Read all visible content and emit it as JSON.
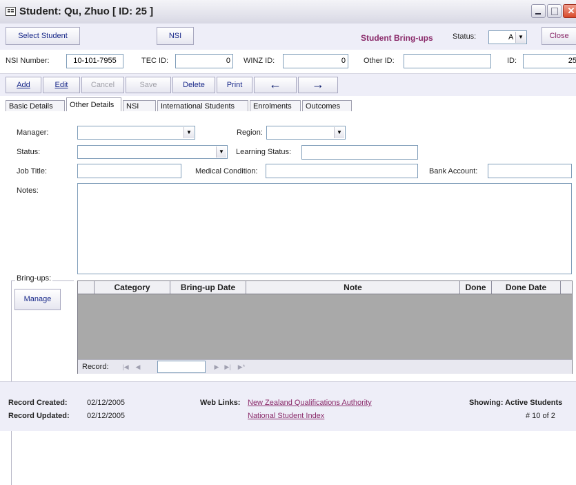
{
  "window": {
    "title": "Student: Qu, Zhuo [ ID: 25 ]"
  },
  "toolbar": {
    "select_student": "Select Student",
    "nsi": "NSI",
    "student_bringups": "Student Bring-ups",
    "status_label": "Status:",
    "status_value": "A",
    "close": "Close"
  },
  "ids": {
    "nsi_number_label": "NSI Number:",
    "nsi_number": "10-101-7955",
    "tec_id_label": "TEC ID:",
    "tec_id": "0",
    "winz_id_label": "WINZ ID:",
    "winz_id": "0",
    "other_id_label": "Other ID:",
    "other_id": "",
    "id_label": "ID:",
    "id": "25"
  },
  "commands": {
    "add": "Add",
    "edit": "Edit",
    "cancel": "Cancel",
    "save": "Save",
    "delete": "Delete",
    "print": "Print",
    "prev_icon": "arrow-left-icon",
    "next_icon": "arrow-right-icon"
  },
  "tabs": [
    "Basic Details",
    "Other Details",
    "NSI",
    "International Students",
    "Enrolments",
    "Outcomes"
  ],
  "form": {
    "manager_label": "Manager:",
    "region_label": "Region:",
    "status_label": "Status:",
    "learning_status_label": "Learning Status:",
    "job_title_label": "Job Title:",
    "medical_condition_label": "Medical Condition:",
    "bank_account_label": "Bank Account:",
    "notes_label": "Notes:"
  },
  "bringups": {
    "label": "Bring-ups:",
    "manage": "Manage",
    "columns": [
      "Category",
      "Bring-up Date",
      "Note",
      "Done",
      "Done Date"
    ],
    "record_label": "Record:",
    "record_value": ""
  },
  "footer": {
    "created_label": "Record Created:",
    "created_value": "02/12/2005",
    "updated_label": "Record Updated:",
    "updated_value": "02/12/2005",
    "weblinks_label": "Web Links:",
    "link1": "New Zealand Qualifications Authority",
    "link2": "National Student Index",
    "showing": "Showing: Active Students",
    "record_count": "# 10 of 2"
  },
  "colors": {
    "accent_text": "#1a2a8a",
    "bringups_title": "#8a2a6a",
    "grid_bg": "#a9a9a9"
  }
}
